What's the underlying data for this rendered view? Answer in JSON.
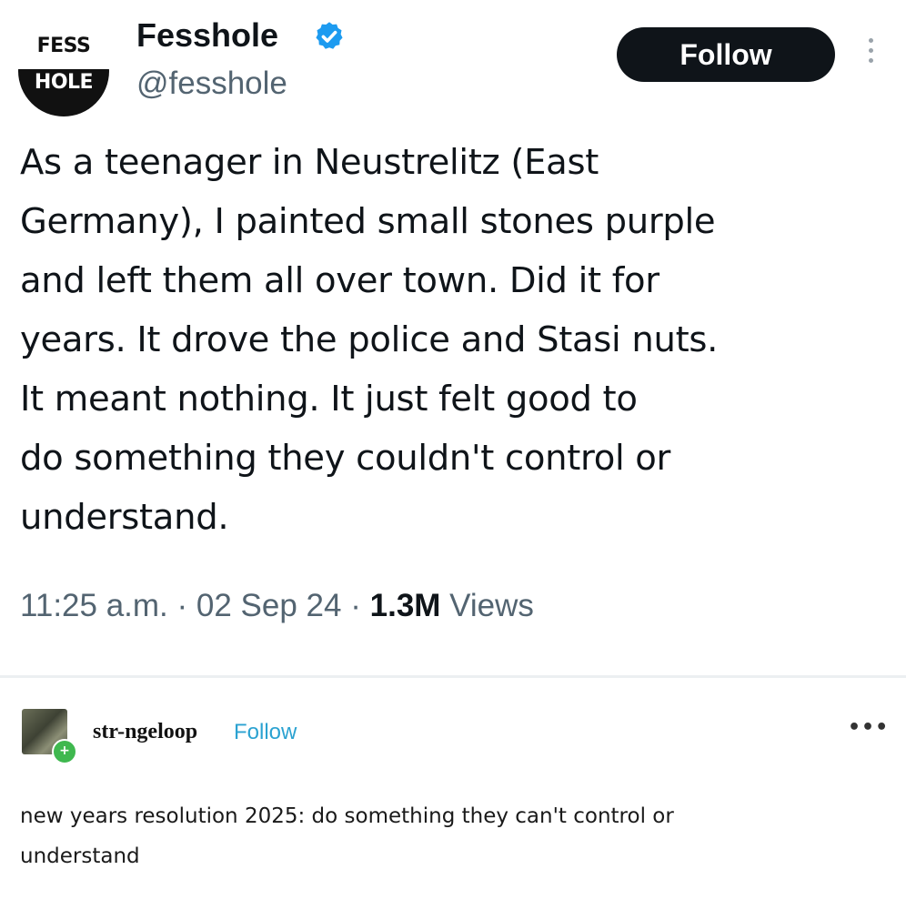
{
  "tweet": {
    "avatar_text_top": "FESS",
    "avatar_text_bottom": "HOLE",
    "display_name": "Fesshole",
    "handle": "@fesshole",
    "follow_label": "Follow",
    "text_lines": [
      "As a teenager in Neustrelitz (East",
      "Germany), I painted small stones purple",
      "and left them all over town. Did it for",
      "years. It drove the police and Stasi nuts.",
      "It meant nothing. It just felt good to",
      "do something they couldn't control or",
      "understand."
    ],
    "time": "11:25 a.m.",
    "date": "02 Sep 24",
    "views_count": "1.3M",
    "views_label": "Views",
    "separator": "·"
  },
  "reply": {
    "username": "str-ngeloop",
    "follow_label": "Follow",
    "more_label": "•••",
    "badge_symbol": "+",
    "text_lines": [
      "new years resolution 2025: do something they can't control or",
      "understand"
    ]
  },
  "colors": {
    "follow_bg": "#0f1419",
    "verified": "#1d9bf0",
    "secondary_text": "#536471",
    "tumblr_follow": "#2ba2d1",
    "badge_green": "#3fb84f"
  }
}
